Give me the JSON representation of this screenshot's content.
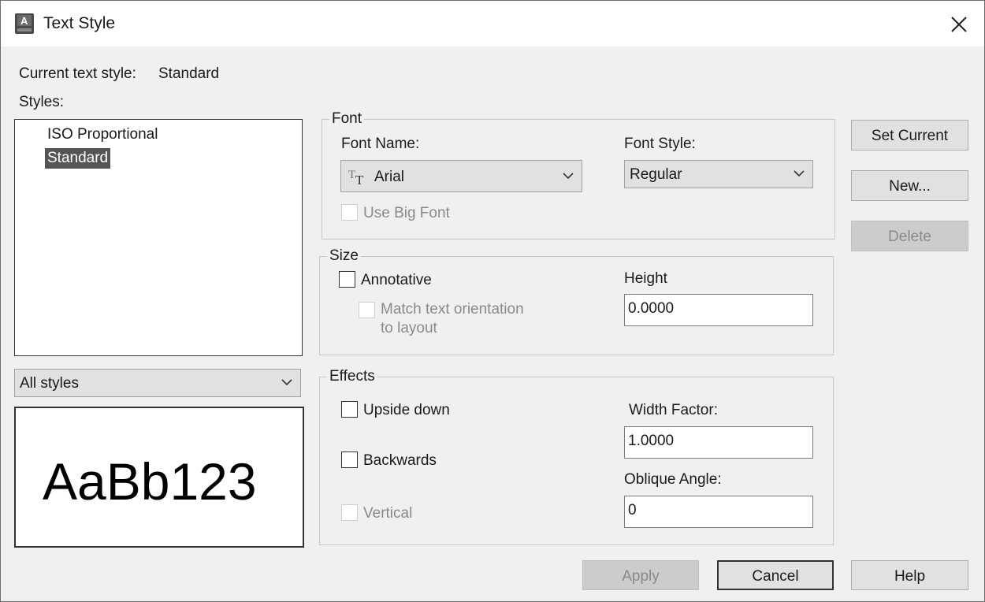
{
  "window": {
    "title": "Text Style"
  },
  "icons": {
    "app": "text-style-app-icon",
    "close": "close-icon",
    "chevron": "chevron-down-icon",
    "truetype": "truetype-font-icon"
  },
  "current": {
    "label": "Current text style:",
    "value": "Standard"
  },
  "styles": {
    "label": "Styles:",
    "items": [
      {
        "label": "ISO Proportional",
        "selected": false
      },
      {
        "label": "Standard",
        "selected": true
      }
    ],
    "filter_value": "All styles"
  },
  "preview": {
    "text": "AaBb123"
  },
  "font": {
    "group_title": "Font",
    "name_label": "Font Name:",
    "name_value": "Arial",
    "style_label": "Font Style:",
    "style_value": "Regular",
    "big_font_label": "Use Big Font",
    "big_font_checked": false
  },
  "size": {
    "group_title": "Size",
    "annotative_label": "Annotative",
    "annotative_checked": false,
    "match_label_line1": "Match text orientation",
    "match_label_line2": "to layout",
    "height_label": "Height",
    "height_value": "0.0000"
  },
  "effects": {
    "group_title": "Effects",
    "upside_down_label": "Upside down",
    "backwards_label": "Backwards",
    "vertical_label": "Vertical",
    "width_factor_label": "Width Factor:",
    "width_factor_value": "1.0000",
    "oblique_label": "Oblique Angle:",
    "oblique_value": "0"
  },
  "buttons": {
    "set_current": "Set Current",
    "new": "New...",
    "delete": "Delete",
    "apply": "Apply",
    "cancel": "Cancel",
    "help": "Help"
  }
}
